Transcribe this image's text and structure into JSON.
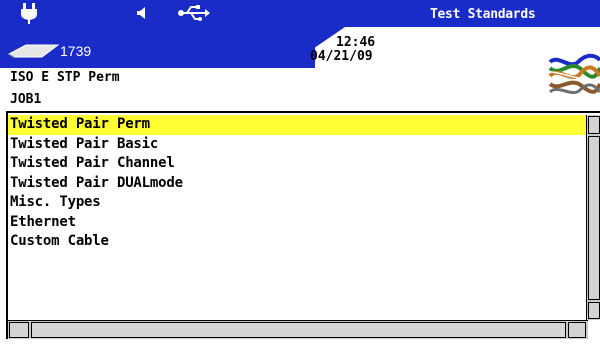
{
  "header": {
    "title": "Test Standards",
    "icons": [
      "plug-icon",
      "speaker-icon",
      "usb-icon",
      "probe-icon"
    ],
    "probe_count": "1739",
    "time": "12:46",
    "date": "04/21/09"
  },
  "info": {
    "standard": "ISO E STP Perm",
    "job": "JOB1"
  },
  "list": {
    "selected_index": 0,
    "items": [
      "Twisted Pair Perm",
      "Twisted Pair Basic",
      "Twisted Pair Channel",
      "Twisted Pair DUALmode",
      "Misc. Types",
      "Ethernet",
      "Custom Cable"
    ]
  },
  "colors": {
    "header_blue": "#1a2cc8",
    "selection_yellow": "#ffff33"
  }
}
